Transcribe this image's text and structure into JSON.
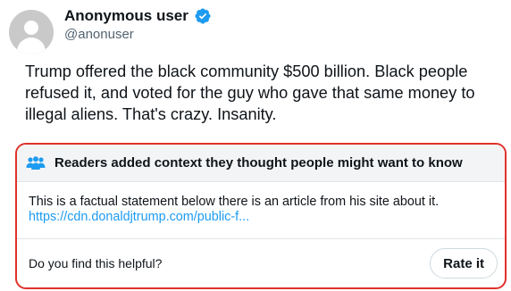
{
  "user": {
    "display_name": "Anonymous user",
    "handle": "@anonuser",
    "verified": true,
    "verified_color": "#1d9bf0"
  },
  "tweet": {
    "text": "Trump offered the black community $500 billion. Black people refused it, and voted for the guy who gave that same money to illegal aliens. That's crazy. Insanity."
  },
  "note": {
    "title": "Readers added context they thought people might want to know",
    "body": "This is a factual statement below there is an article from his site about it.",
    "link": "https://cdn.donaldjtrump.com/public-f...",
    "question": "Do you find this helpful?",
    "rate_label": "Rate it",
    "border_color": "#e0312b",
    "icon": "readers-icon"
  }
}
